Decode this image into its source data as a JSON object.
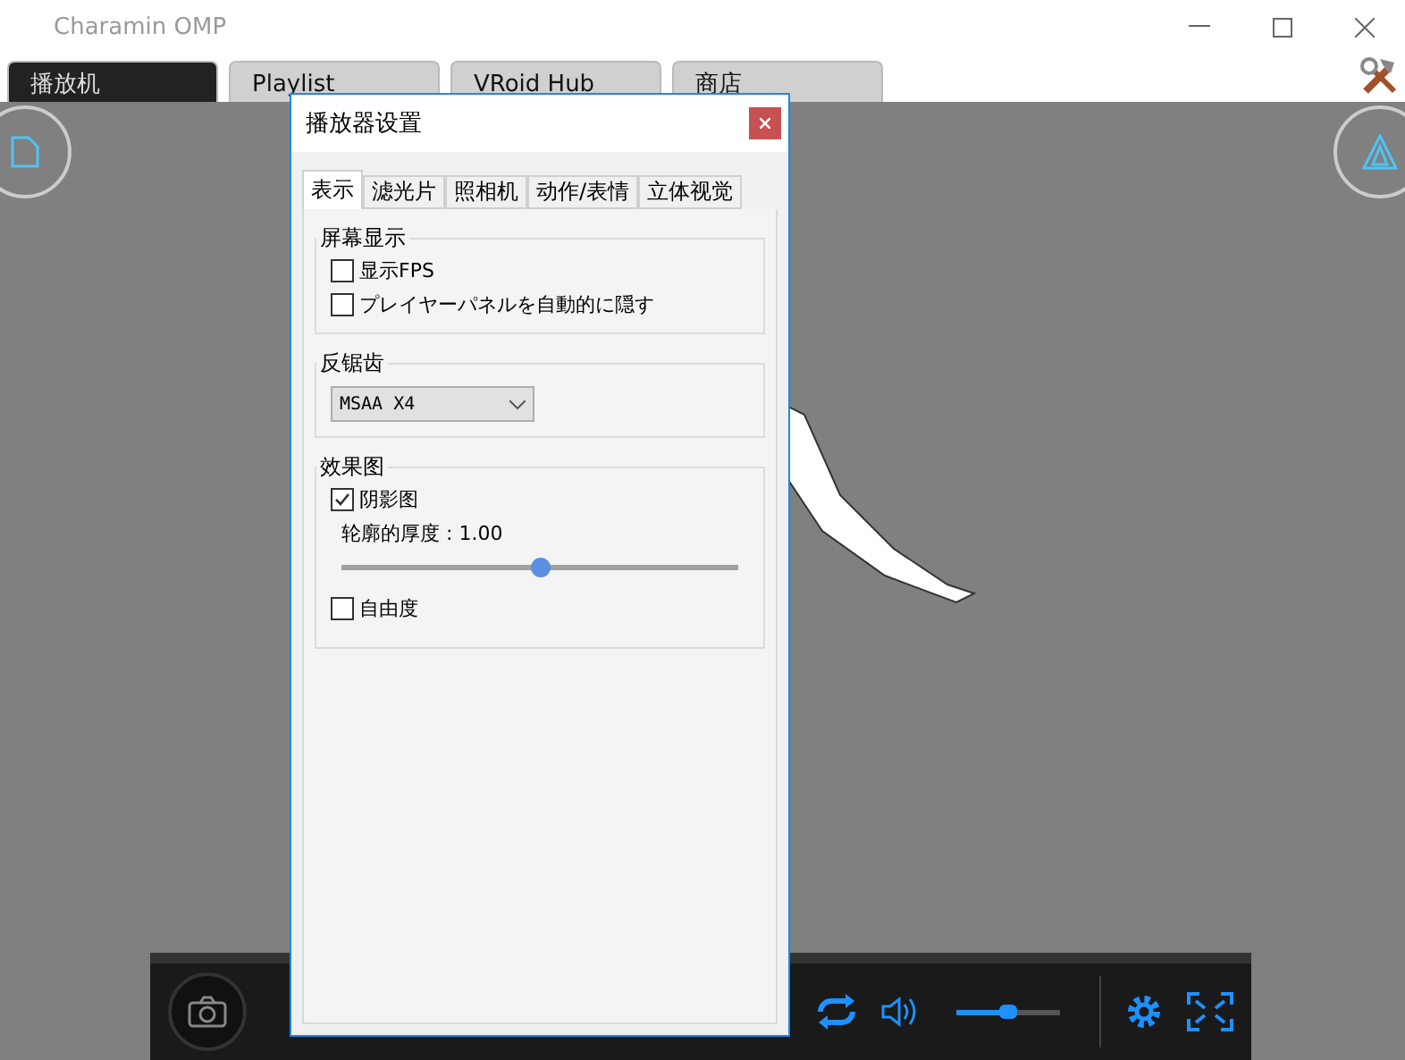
{
  "window": {
    "title": "Charamin OMP"
  },
  "tabs": [
    {
      "label": "播放机",
      "selected": true
    },
    {
      "label": "Playlist",
      "selected": false
    },
    {
      "label": "VRoid Hub",
      "selected": false
    },
    {
      "label": "商店",
      "selected": false
    }
  ],
  "player_bar": {
    "volume": {
      "level": 0.5
    }
  },
  "dialog": {
    "title": "播放器设置",
    "tabs": [
      {
        "label": "表示",
        "selected": true
      },
      {
        "label": "滤光片",
        "selected": false
      },
      {
        "label": "照相机",
        "selected": false
      },
      {
        "label": "动作/表情",
        "selected": false
      },
      {
        "label": "立体视觉",
        "selected": false
      }
    ],
    "screen_display": {
      "title": "屏幕显示",
      "options": [
        {
          "label": "显示FPS",
          "checked": false
        },
        {
          "label": "プレイヤーパネルを自動的に隠す",
          "checked": false
        }
      ]
    },
    "antialiasing": {
      "title": "反锯齿",
      "value": "MSAA X4"
    },
    "effects": {
      "title": "效果图",
      "shadow": {
        "label": "阴影图",
        "checked": true
      },
      "outline": {
        "label": "轮廓的厚度 : 1.00",
        "level": 0.5
      },
      "freedom": {
        "label": "自由度",
        "checked": false
      }
    }
  }
}
